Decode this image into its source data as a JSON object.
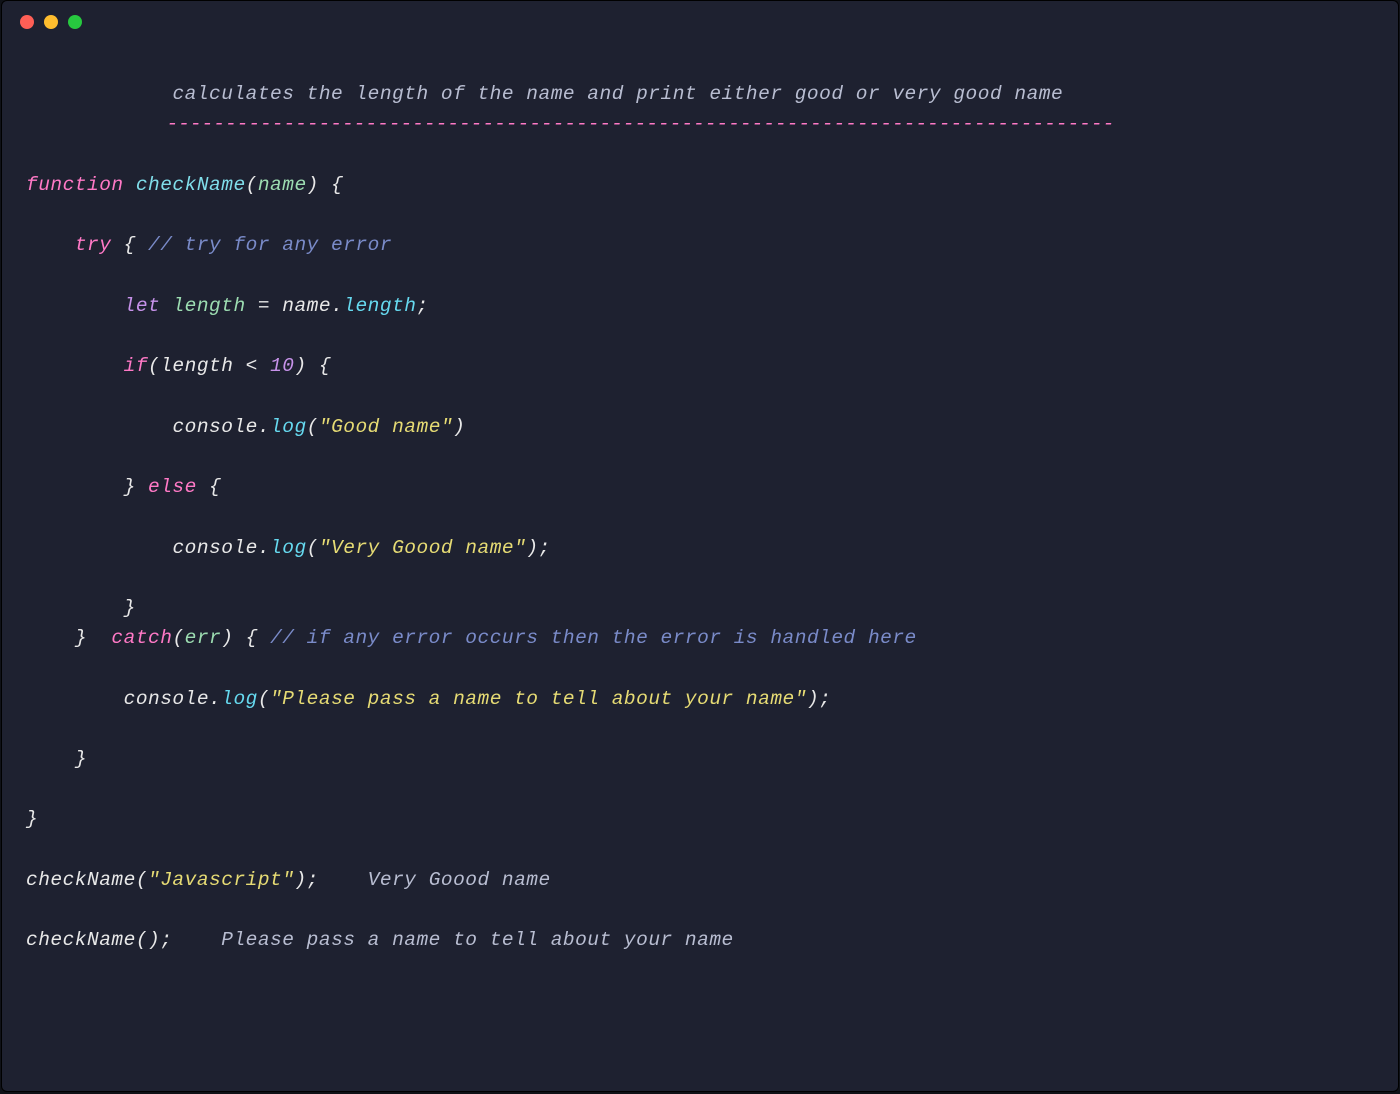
{
  "window": {
    "traffic_lights": {
      "close": "#ff5f56",
      "minimize": "#ffbd2e",
      "maximize": "#27c93f"
    }
  },
  "code": {
    "header_comment": "calculates the length of the name and print either good or very good name",
    "dash_line": "---------------------------------------------------------------------------------",
    "kw_function": "function",
    "fn_name": "checkName",
    "param": "name",
    "brace_open": "{",
    "brace_close": "}",
    "paren_open": "(",
    "paren_close": ")",
    "kw_try": "try",
    "comment_try": "// try for any error",
    "kw_let": "let",
    "var_length": "length",
    "eq": " = ",
    "id_name": "name",
    "dot": ".",
    "prop_length": "length",
    "semi": ";",
    "kw_if": "if",
    "op_lt": " < ",
    "num_10": "10",
    "console": "console",
    "method_log": "log",
    "str_good": "\"Good name\"",
    "kw_else": "else",
    "str_verygood": "\"Very Goood name\"",
    "kw_catch": "catch",
    "param_err": "err",
    "comment_catch": "// if any error occurs then the error is handled here",
    "str_please": "\"Please pass a name to tell about your name\"",
    "call1_fn": "checkName",
    "call1_arg": "\"Javascript\"",
    "call1_out": "Very Goood name",
    "call2_fn": "checkName",
    "call2_out": "Please pass a name to tell about your name"
  }
}
